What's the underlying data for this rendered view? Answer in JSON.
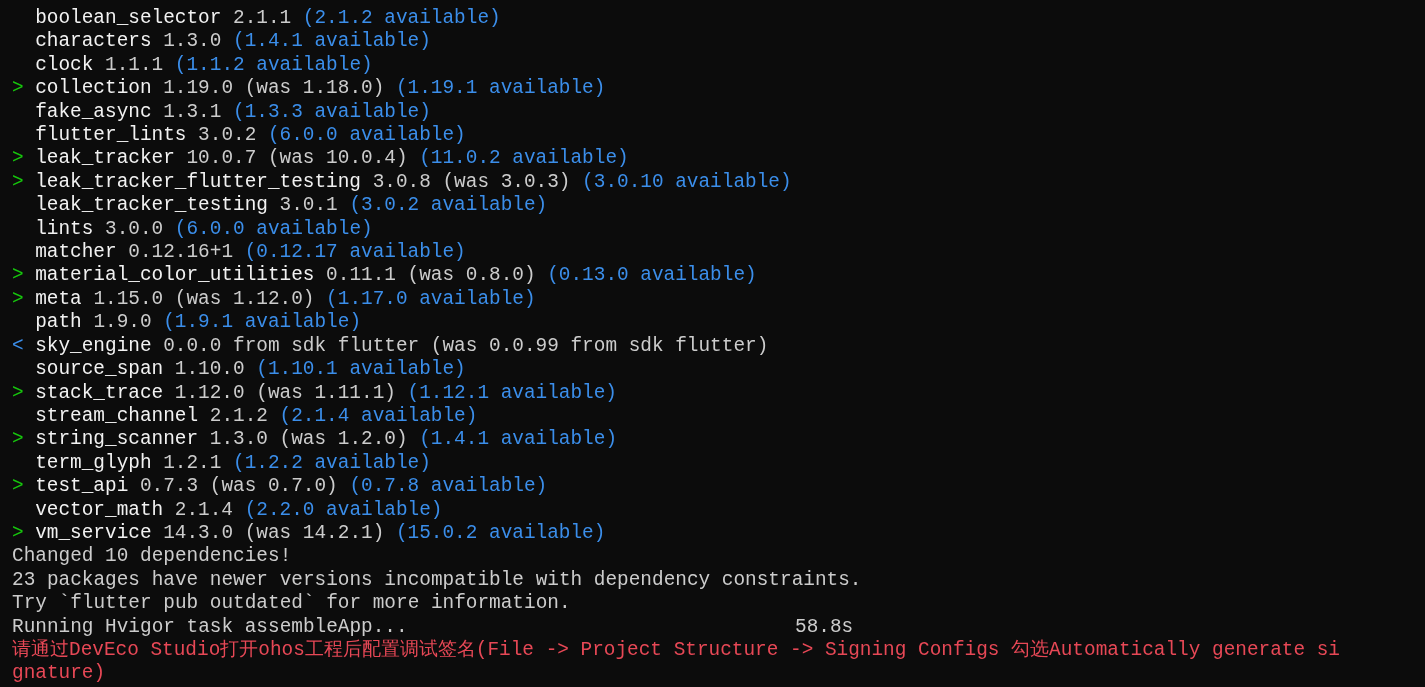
{
  "packages": [
    {
      "name": "boolean_selector",
      "detail": "2.1.1",
      "available": "(2.1.2 available)"
    },
    {
      "name": "characters",
      "detail": "1.3.0",
      "available": "(1.4.1 available)"
    },
    {
      "name": "clock",
      "detail": "1.1.1",
      "available": "(1.1.2 available)"
    },
    {
      "marker": ">",
      "kind": "upgraded",
      "name": "collection",
      "detail": "1.19.0 (was 1.18.0)",
      "available": "(1.19.1 available)"
    },
    {
      "name": "fake_async",
      "detail": "1.3.1",
      "available": "(1.3.3 available)"
    },
    {
      "name": "flutter_lints",
      "detail": "3.0.2",
      "available": "(6.0.0 available)"
    },
    {
      "marker": ">",
      "kind": "upgraded",
      "name": "leak_tracker",
      "detail": "10.0.7 (was 10.0.4)",
      "available": "(11.0.2 available)"
    },
    {
      "marker": ">",
      "kind": "upgraded",
      "name": "leak_tracker_flutter_testing",
      "detail": "3.0.8 (was 3.0.3)",
      "available": "(3.0.10 available)"
    },
    {
      "name": "leak_tracker_testing",
      "detail": "3.0.1",
      "available": "(3.0.2 available)"
    },
    {
      "name": "lints",
      "detail": "3.0.0",
      "available": "(6.0.0 available)"
    },
    {
      "name": "matcher",
      "detail": "0.12.16+1",
      "available": "(0.12.17 available)"
    },
    {
      "marker": ">",
      "kind": "upgraded",
      "name": "material_color_utilities",
      "detail": "0.11.1 (was 0.8.0)",
      "available": "(0.13.0 available)"
    },
    {
      "marker": ">",
      "kind": "upgraded",
      "name": "meta",
      "detail": "1.15.0 (was 1.12.0)",
      "available": "(1.17.0 available)"
    },
    {
      "name": "path",
      "detail": "1.9.0",
      "available": "(1.9.1 available)"
    },
    {
      "marker": "<",
      "kind": "downgraded",
      "name": "sky_engine",
      "detail": "0.0.0 from sdk flutter (was 0.0.99 from sdk flutter)"
    },
    {
      "name": "source_span",
      "detail": "1.10.0",
      "available": "(1.10.1 available)"
    },
    {
      "marker": ">",
      "kind": "upgraded",
      "name": "stack_trace",
      "detail": "1.12.0 (was 1.11.1)",
      "available": "(1.12.1 available)"
    },
    {
      "name": "stream_channel",
      "detail": "2.1.2",
      "available": "(2.1.4 available)"
    },
    {
      "marker": ">",
      "kind": "upgraded",
      "name": "string_scanner",
      "detail": "1.3.0 (was 1.2.0)",
      "available": "(1.4.1 available)"
    },
    {
      "name": "term_glyph",
      "detail": "1.2.1",
      "available": "(1.2.2 available)"
    },
    {
      "marker": ">",
      "kind": "upgraded",
      "name": "test_api",
      "detail": "0.7.3 (was 0.7.0)",
      "available": "(0.7.8 available)"
    },
    {
      "name": "vector_math",
      "detail": "2.1.4",
      "available": "(2.2.0 available)"
    },
    {
      "marker": ">",
      "kind": "upgraded",
      "name": "vm_service",
      "detail": "14.3.0 (was 14.2.1)",
      "available": "(15.0.2 available)"
    }
  ],
  "messages": [
    "Changed 10 dependencies!",
    "23 packages have newer versions incompatible with dependency constraints.",
    "Try `flutter pub outdated` for more information."
  ],
  "task": {
    "text": "Running Hvigor task assembleApp...",
    "time": "58.8s"
  },
  "error_lines": [
    "请通过DevEco Studio打开ohos工程后配置调试签名(File -> Project Structure -> Signing Configs 勾选Automatically generate si",
    "gnature)"
  ]
}
